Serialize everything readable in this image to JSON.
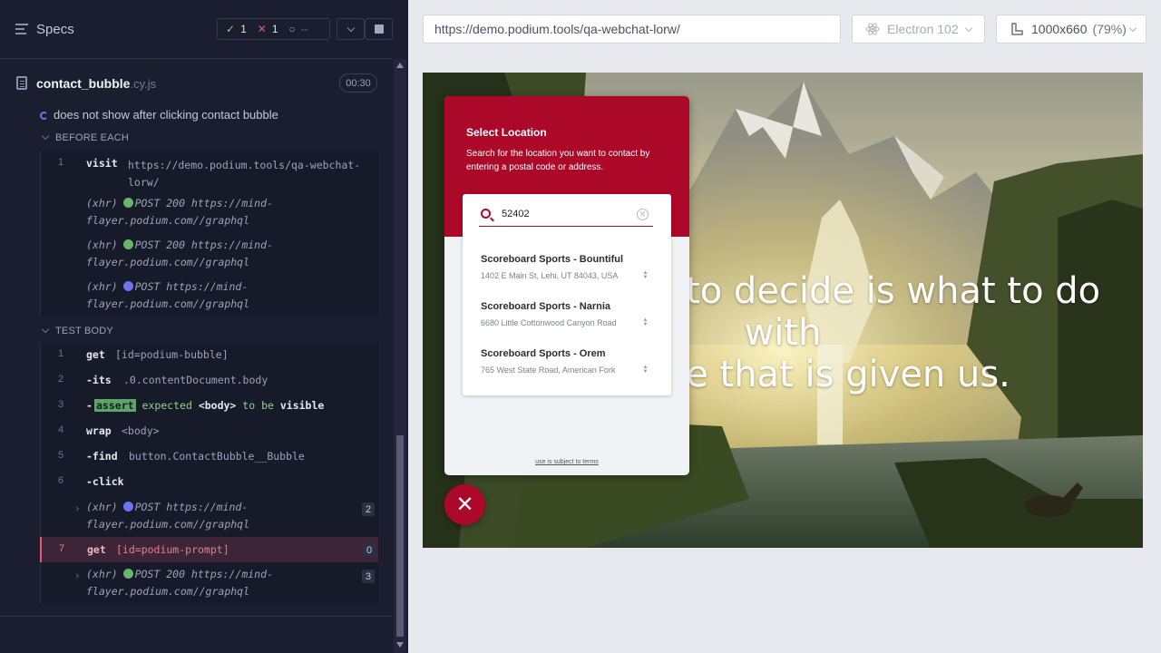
{
  "reporter": {
    "header": {
      "title": "Specs",
      "passed": "1",
      "failed": "1",
      "pending": "--"
    },
    "spec": {
      "file_name": "contact_bubble",
      "file_ext": ".cy.js",
      "duration": "00:30"
    },
    "test": {
      "title": "does not show after clicking contact bubble"
    },
    "before_each": {
      "label": "BEFORE EACH",
      "commands": [
        {
          "num": "1",
          "name": "visit",
          "message": "https://demo.podium.tools/qa-webchat-\nlorw/"
        },
        {
          "prefix": "(xhr)",
          "method": "POST 200 https://mind-",
          "cont": "flayer.podium.com//graphql"
        },
        {
          "prefix": "(xhr)",
          "method": "POST 200 https://mind-",
          "cont": "flayer.podium.com//graphql"
        },
        {
          "prefix": "(xhr)",
          "method": "POST https://mind-",
          "cont": "flayer.podium.com//graphql"
        }
      ]
    },
    "test_body": {
      "label": "TEST BODY",
      "commands": [
        {
          "num": "1",
          "name": "get",
          "message": "[id=podium-bubble]"
        },
        {
          "num": "2",
          "name": "-its",
          "message": ".0.contentDocument.body"
        },
        {
          "num": "3",
          "name": "-",
          "tag": "assert",
          "expected": "expected",
          "subject": "<body>",
          "to_be": "to be",
          "state": "visible"
        },
        {
          "num": "4",
          "name": "wrap",
          "message": "<body>"
        },
        {
          "num": "5",
          "name": "-find",
          "message": "button.ContactBubble__Bubble"
        },
        {
          "num": "6",
          "name": "-click",
          "message": ""
        },
        {
          "prefix": "(xhr)",
          "method": "POST https://mind-",
          "cont": "flayer.podium.com//graphql",
          "count": "2"
        },
        {
          "num": "7",
          "name": "get",
          "message": "[id=podium-prompt]",
          "count": "0"
        },
        {
          "prefix": "(xhr)",
          "method": "POST 200 https://mind-",
          "cont": "flayer.podium.com//graphql",
          "count": "3"
        }
      ]
    }
  },
  "preview": {
    "url": "https://demo.podium.tools/qa-webchat-lorw/",
    "browser": "Electron 102",
    "viewport": "1000x660",
    "scale": "(79%)",
    "hero_line1": "All we have to decide is what to do with",
    "hero_line2": "the time that is given us.",
    "widget": {
      "title": "Select Location",
      "subtitle": "Search for the location you want to contact by entering a postal code or address.",
      "search_value": "52402",
      "locations": [
        {
          "name": "Scoreboard Sports - Bountiful",
          "address": "1402 E Main St, Lehi, UT 84043, USA"
        },
        {
          "name": "Scoreboard Sports - Narnia",
          "address": "6680 Little Cottonwood Canyon Road"
        },
        {
          "name": "Scoreboard Sports - Orem",
          "address": "765 West State Road, American Fork"
        }
      ],
      "terms": "use is subject to terms"
    }
  },
  "colors": {
    "reporter_bg": "#1b1e2e",
    "accent_red": "#ac0829",
    "pass_green": "#8fcf8a",
    "fail_red": "#e45770",
    "pending_purple": "#6e73f0"
  }
}
